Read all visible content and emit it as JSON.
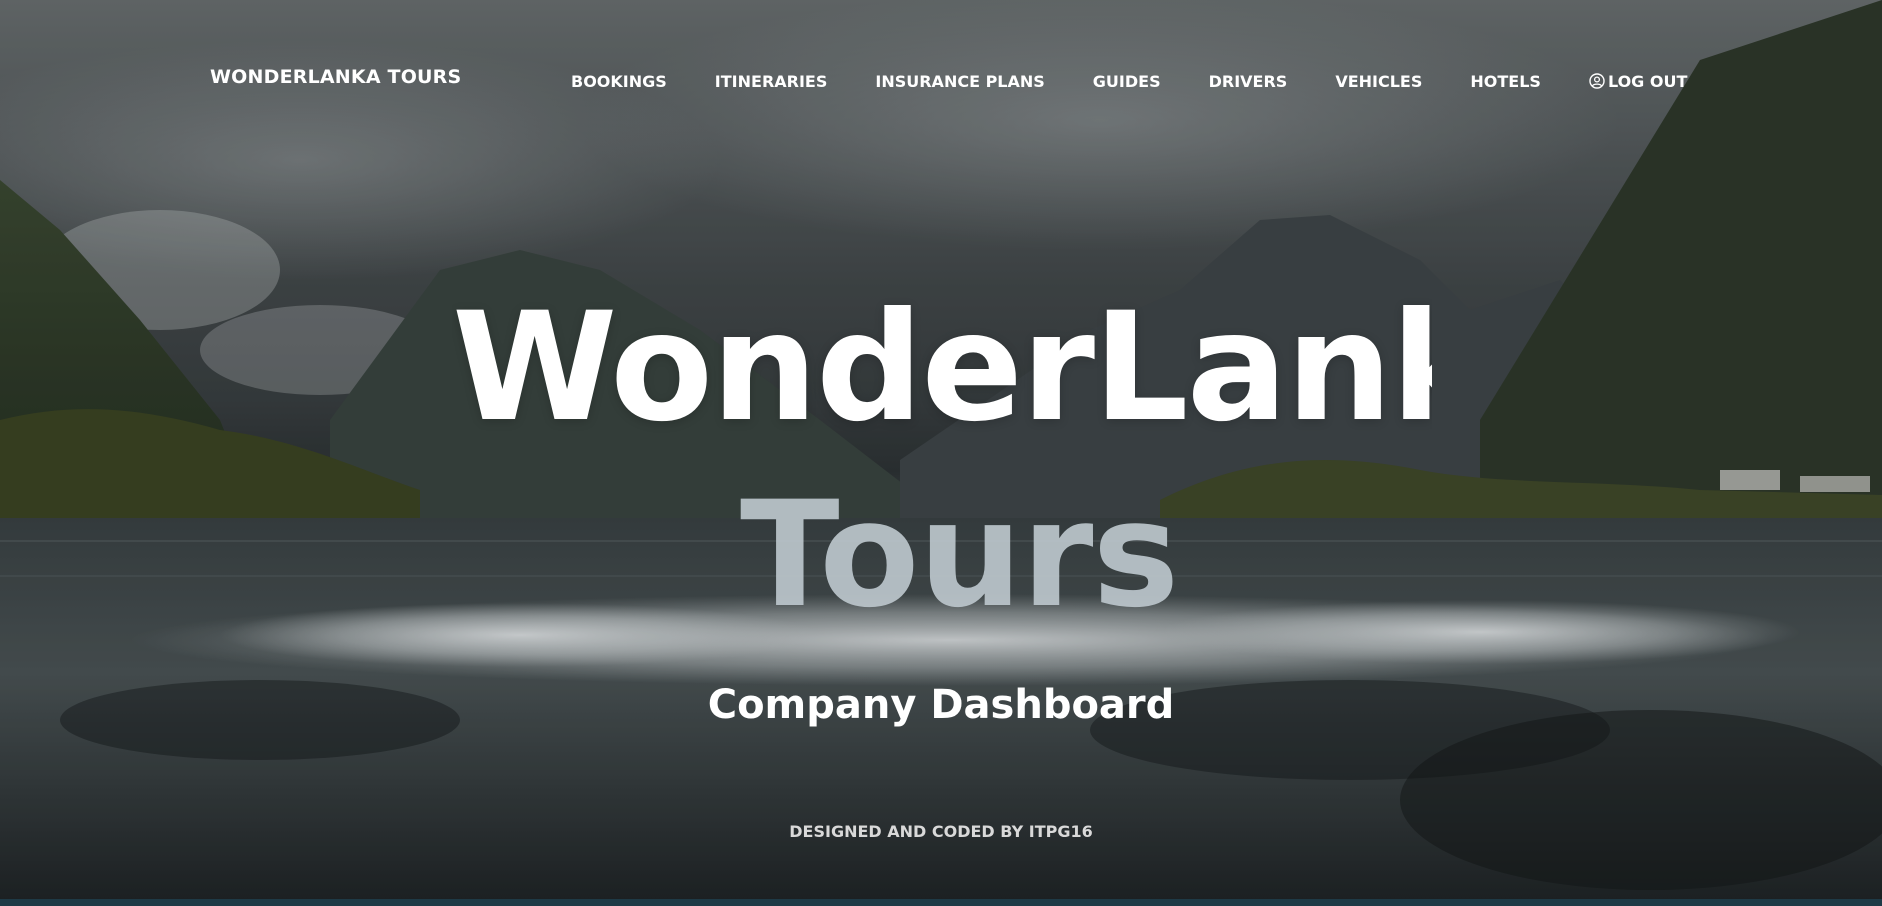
{
  "header": {
    "brand": "WONDERLANKA TOURS"
  },
  "nav": {
    "items": [
      {
        "label": "BOOKINGS"
      },
      {
        "label": "ITINERARIES"
      },
      {
        "label": "INSURANCE PLANS"
      },
      {
        "label": "GUIDES"
      },
      {
        "label": "DRIVERS"
      },
      {
        "label": "VEHICLES"
      },
      {
        "label": "HOTELS"
      },
      {
        "label": "LOG OUT",
        "icon": "user-circle-icon"
      }
    ]
  },
  "hero": {
    "title_line1": "WonderLanka",
    "title_line2": "Tours",
    "subtitle": "Company Dashboard"
  },
  "footer": {
    "credit": "DESIGNED AND CODED BY ITPG16"
  },
  "colors": {
    "text": "#ffffff",
    "title_line2": "#bcc6cc",
    "footer_text": "#d9d9d9",
    "bottom_strip": "#1e3a46"
  }
}
